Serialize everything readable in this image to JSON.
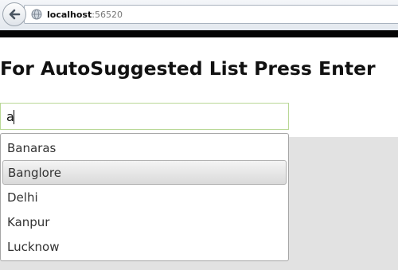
{
  "browser": {
    "url_host": "localhost",
    "url_port": ":56520",
    "back_icon": "back-arrow-icon",
    "site_icon": "globe-icon"
  },
  "page": {
    "title": "For AutoSuggested List Press Enter"
  },
  "search": {
    "value": "a"
  },
  "suggestions": {
    "items": [
      "Banaras",
      "Banglore",
      "Delhi",
      "Kanpur",
      "Lucknow"
    ],
    "highlighted": "Banglore"
  },
  "colors": {
    "input_border": "#b9d896",
    "panel_background": "#e2e2e2",
    "chrome_separator": "#050505"
  }
}
